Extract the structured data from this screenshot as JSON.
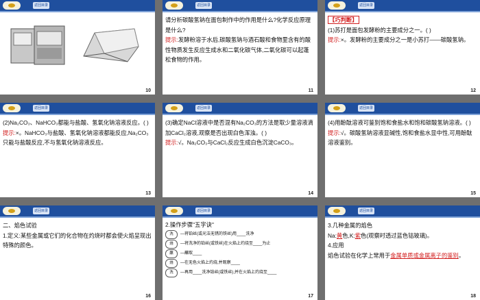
{
  "back_label": "返回目录",
  "slides": {
    "s10": {
      "page": "10"
    },
    "s11": {
      "page": "11",
      "q": "请分析碳酸氢钠在面包制作中的作用是什么?化学反应原理是什么?",
      "hint_label": "提示:",
      "hint": "发酵粉溶于水后,碳酸氢钠与酒石酸和食物里含有的酸性物质发生反应生成水和二氧化碳气体,二氧化碳可以起蓬松食物的作用。"
    },
    "s12": {
      "page": "12",
      "tag": "【巧判断】",
      "q": "(1)苏打是面包发酵粉的主要成分之一。(     )",
      "hint_label": "提示:",
      "hint": "×。发酵粉的主要成分之一是小苏打——碳酸氢钠。"
    },
    "s13": {
      "page": "13",
      "q": "(2)Na₂CO₃、NaHCO₃都能与盐酸、氢氧化钠溶液反应。(     )",
      "hint_label": "提示:",
      "hint": "×。NaHCO₃与盐酸、氢氧化钠溶液都能反应,Na₂CO₃只能与盐酸反应,不与氢氧化钠溶液反应。"
    },
    "s14": {
      "page": "14",
      "q": "(3)确定NaCl溶液中是否混有Na₂CO₃的方法是取少量溶液滴加CaCl₂溶液,观察是否出现白色浑浊。(     )",
      "hint_label": "提示:",
      "hint": "√。Na₂CO₃与CaCl₂反应生成白色沉淀CaCO₃。"
    },
    "s15": {
      "page": "15",
      "q": "(4)用酚酞溶液可鉴别饱和食盐水和饱和碳酸氢钠溶液。(     )",
      "hint_label": "提示:",
      "hint": "√。碳酸氢钠溶液显碱性,饱和食盐水显中性,可用酚酞溶液鉴别。"
    },
    "s16": {
      "page": "16",
      "title": "二、焰色试验",
      "def": "1.定义:某些金属或它们的化合物在灼烧时都会使火焰呈现出特殊的颜色。"
    },
    "s17": {
      "page": "17",
      "title": "2.操作步骤\"五字诀\"",
      "steps": [
        {
          "k": "洗",
          "t": "—将铂丝(或光洁无锈的铁丝)用____洗净"
        },
        {
          "k": "烧",
          "t": "—将洗净的铂丝(或铁丝)在火焰上灼烧至____为止"
        },
        {
          "k": "蘸",
          "t": "—蘸取____"
        },
        {
          "k": "烧",
          "t": "—在无色火焰上灼烧,并观察____"
        },
        {
          "k": "洗",
          "t": "—再用____洗净铂丝(或铁丝),并在火焰上灼烧至____"
        }
      ]
    },
    "s18": {
      "page": "18",
      "line1": "3.几种金属的焰色",
      "na_a": "Na:",
      "na_ans": "黄",
      "na_b": "色,K:",
      "k_ans": "紫",
      "k_b": "色(观察时透过蓝色钴玻璃)。",
      "line3": "4.应用",
      "line4": "焰色试验在化学上常用于",
      "use_ans": "金属单质或金属离子的鉴别",
      "line4_end": "。"
    }
  }
}
